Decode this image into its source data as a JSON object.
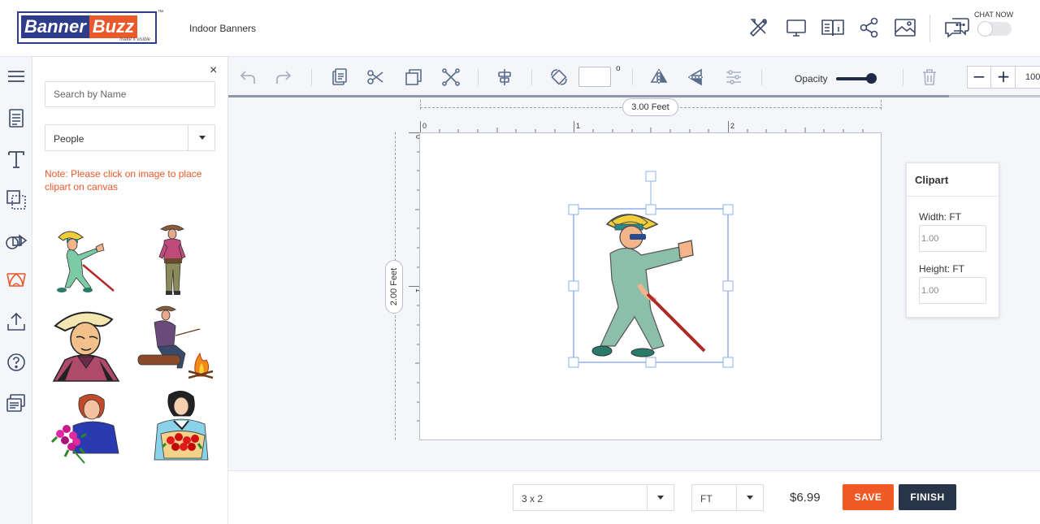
{
  "header": {
    "logo": {
      "word1": "Banner",
      "word2": "Buzz",
      "tagline": "make it visible",
      "tm": "™"
    },
    "title": "Indoor Banners",
    "icons": [
      "design-tools-icon",
      "desktop-preview-icon",
      "catalog-info-icon",
      "share-icon",
      "image-gallery-icon",
      "chat-icon"
    ],
    "chat_label": "CHAT NOW",
    "chat_toggle_on": false
  },
  "rail": {
    "items": [
      "menu-icon",
      "templates-icon",
      "text-icon",
      "background-icon",
      "shapes-icon",
      "clipart-icon",
      "upload-icon",
      "help-icon",
      "order-notes-icon"
    ],
    "active": "clipart-icon"
  },
  "panel": {
    "close": "×",
    "search_placeholder": "Search by Name",
    "category": "People",
    "note": "Note: Please click on image to place clipart on canvas",
    "clipart": [
      "man-with-cane",
      "cowboy-standing",
      "cowboy-portrait",
      "man-by-campfire",
      "woman-with-flowers",
      "woman-with-roses"
    ]
  },
  "toolbar": {
    "tools": [
      "undo-icon",
      "redo-icon",
      "paste-icon",
      "cut-icon",
      "copy-icon",
      "delete-element-icon",
      "align-center-icon",
      "rotate-icon",
      "flip-horizontal-icon",
      "flip-vertical-icon",
      "adjust-icon",
      "trash-icon"
    ],
    "rotation_value": "",
    "degree_symbol": "o",
    "opacity_label": "Opacity",
    "opacity_value": 1.0,
    "zoom_minus": "−",
    "zoom_plus": "+",
    "zoom_value": "100"
  },
  "canvas": {
    "width_label": "3.00 Feet",
    "height_label": "2.00 Feet",
    "ruler_h_labels": [
      "0",
      "1",
      "2"
    ],
    "ruler_v_labels": [
      "0",
      "1"
    ],
    "placed_clipart": "man-with-cane"
  },
  "clipart_props": {
    "title": "Clipart",
    "width_label": "Width: FT",
    "width_value": "1.00",
    "height_label": "Height: FT",
    "height_value": "1.00"
  },
  "footer": {
    "size_value": "3 x 2",
    "unit_value": "FT",
    "price": "$6.99",
    "save_label": "SAVE",
    "finish_label": "FINISH"
  },
  "colors": {
    "brand_blue": "#2f3c8c",
    "brand_orange": "#e9592b",
    "save_button": "#ef5a24",
    "finish_button": "#283449",
    "selection": "#8fb0e8"
  }
}
